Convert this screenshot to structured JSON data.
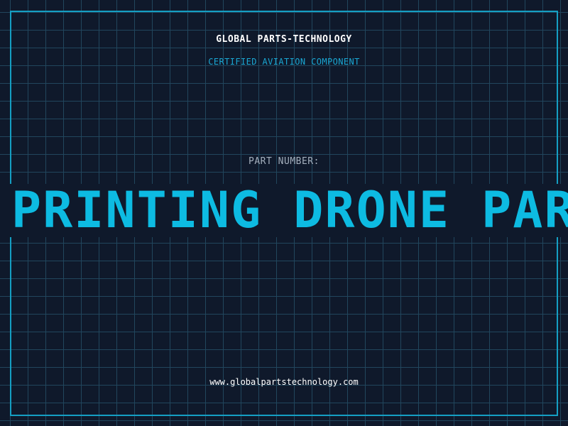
{
  "header": {
    "company": "GLOBAL PARTS-TECHNOLOGY",
    "subtitle": "CERTIFIED AVIATION COMPONENT"
  },
  "part": {
    "label": "PART NUMBER:",
    "number": "PRINTING DRONE PARTS"
  },
  "footer": {
    "website": "www.globalpartstechnology.com"
  },
  "colors": {
    "background": "#0f192b",
    "grid": "#21465d",
    "accent": "#0dbbe2",
    "frame": "#159fc3",
    "label": "#a4afbd",
    "text": "#ffffff"
  }
}
